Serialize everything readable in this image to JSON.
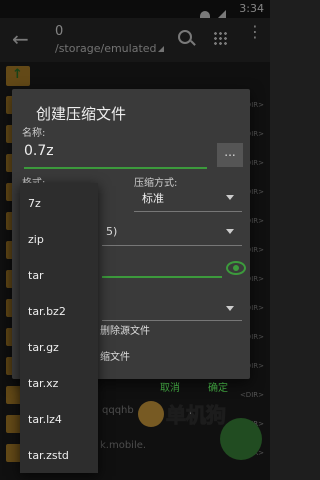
{
  "status_bar": {
    "time": "3:34"
  },
  "toolbar": {
    "title": "0",
    "path": "/storage/emulated"
  },
  "background": {
    "dir_label": "<DIR>",
    "partial_text_1": "qqqhb",
    "partial_text_2": "k.mobile.",
    "watermark_text": "单机狗"
  },
  "dialog": {
    "title": "创建压缩文件",
    "name_label": "名称:",
    "name_value": "0.7z",
    "more_button": "...",
    "format_label": "格式:",
    "compression_label": "压缩方式:",
    "compression_value": "标准",
    "partial_value": "5)",
    "checkbox_delete_source": "删除源文件",
    "checkbox_partial": "缩文件",
    "cancel_button": "取消",
    "ok_button": "确定"
  },
  "format_dropdown": {
    "options": [
      "7z",
      "zip",
      "tar",
      "tar.bz2",
      "tar.gz",
      "tar.xz",
      "tar.lz4",
      "tar.zstd"
    ]
  }
}
